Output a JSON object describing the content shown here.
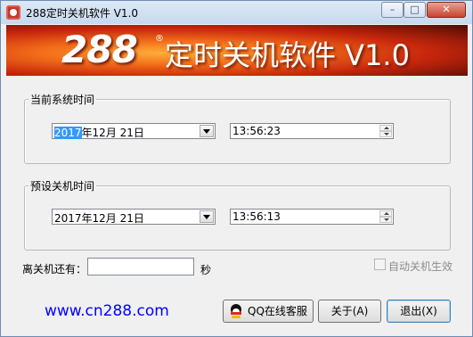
{
  "window": {
    "title": "288定时关机软件 V1.0",
    "controls": {
      "minimize": "–",
      "maximize": "□",
      "close": "✕"
    }
  },
  "banner": {
    "logo": "288",
    "reg_mark": "®",
    "title": "定时关机软件 V1.0"
  },
  "current_time": {
    "legend": "当前系统时间",
    "date_year": "2017",
    "date_rest": "年12月 21日",
    "time": "13:56:23"
  },
  "shutdown_time": {
    "legend": "预设关机时间",
    "date": "2017年12月 21日",
    "time": "13:56:13"
  },
  "remaining": {
    "label": "离关机还有：",
    "value": "",
    "unit": "秒"
  },
  "auto_shutdown": {
    "label": "自动关机生效",
    "checked": false
  },
  "footer": {
    "website": "www.cn288.com",
    "qq_button": "QQ在线客服",
    "about_button": "关于(A)",
    "exit_button": "退出(X)"
  },
  "icons": {
    "app": "alarm-clock-icon",
    "qq": "qq-penguin-icon"
  }
}
